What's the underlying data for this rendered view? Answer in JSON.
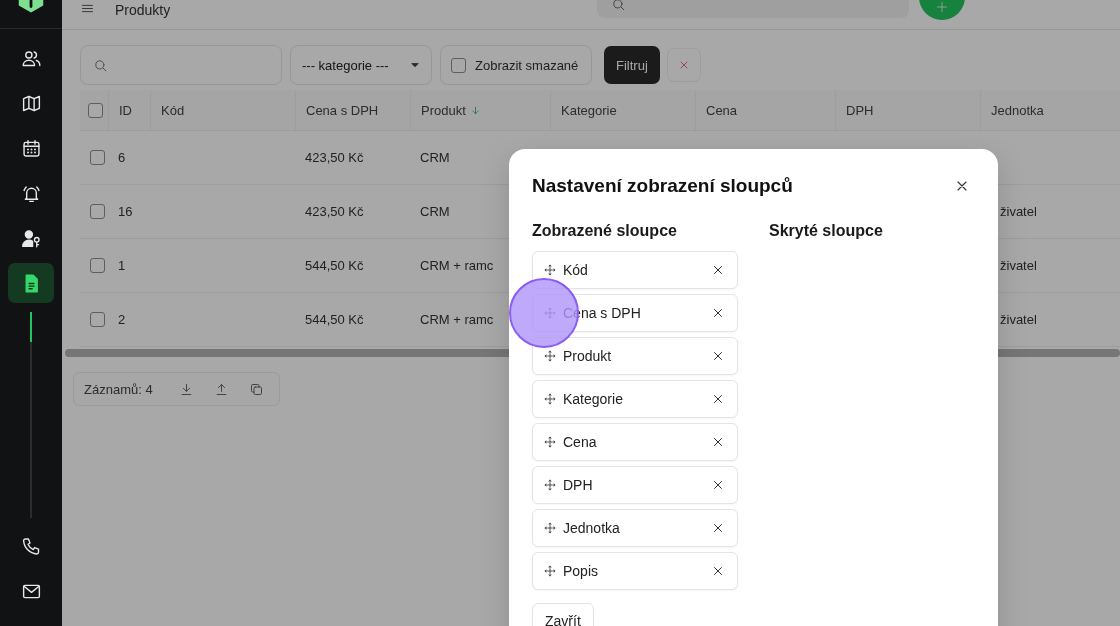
{
  "sidebar": {
    "items": [
      {
        "kind": "users",
        "selected": false
      },
      {
        "kind": "map",
        "selected": false
      },
      {
        "kind": "calendar",
        "selected": false
      },
      {
        "kind": "alarm",
        "selected": false
      },
      {
        "kind": "user-key",
        "selected": false
      },
      {
        "kind": "document",
        "selected": true
      }
    ],
    "bottom_items": [
      {
        "kind": "phone",
        "selected": false
      },
      {
        "kind": "mail",
        "selected": false
      }
    ]
  },
  "header": {
    "title": "Produkty"
  },
  "toolbar": {
    "category_select": {
      "value": "--- kategorie ---"
    },
    "show_deleted": {
      "label": "Zobrazit smazané",
      "checked": false
    },
    "filter_button": "Filtruj"
  },
  "table": {
    "select_all": {
      "checked": false
    },
    "columns": [
      {
        "label": "ID",
        "sorted": false
      },
      {
        "label": "Kód",
        "sorted": false
      },
      {
        "label": "Cena s DPH",
        "sorted": false
      },
      {
        "label": "Produkt",
        "sorted": true
      },
      {
        "label": "Kategorie",
        "sorted": false
      },
      {
        "label": "Cena",
        "sorted": false
      },
      {
        "label": "DPH",
        "sorted": false
      },
      {
        "label": "Jednotka",
        "sorted": false
      }
    ],
    "rows": [
      {
        "checked": false,
        "id": "6",
        "price_vat": "423,50 Kč",
        "product": "CRM"
      },
      {
        "checked": false,
        "id": "16",
        "price_vat": "423,50 Kč",
        "product": "CRM",
        "unit": "živatel"
      },
      {
        "checked": false,
        "id": "1",
        "price_vat": "544,50 Kč",
        "product": "CRM + ramc",
        "unit": "živatel"
      },
      {
        "checked": false,
        "id": "2",
        "price_vat": "544,50 Kč",
        "product": "CRM + ramc",
        "unit": "živatel"
      }
    ]
  },
  "footer": {
    "record_count": "Záznamů: 4"
  },
  "dialog": {
    "title": "Nastavení zobrazení sloupců",
    "shown_columns": {
      "heading": "Zobrazené sloupce",
      "items": [
        {
          "label": "Kód",
          "pressed": false
        },
        {
          "label": "Cena s DPH",
          "pressed": true
        },
        {
          "label": "Produkt",
          "pressed": false
        },
        {
          "label": "Kategorie",
          "pressed": false
        },
        {
          "label": "Cena",
          "pressed": false
        },
        {
          "label": "DPH",
          "pressed": false
        },
        {
          "label": "Jednotka",
          "pressed": false
        },
        {
          "label": "Popis",
          "pressed": false
        }
      ]
    },
    "hidden_columns": {
      "heading": "Skryté sloupce"
    },
    "close_button": "Zavřít"
  }
}
